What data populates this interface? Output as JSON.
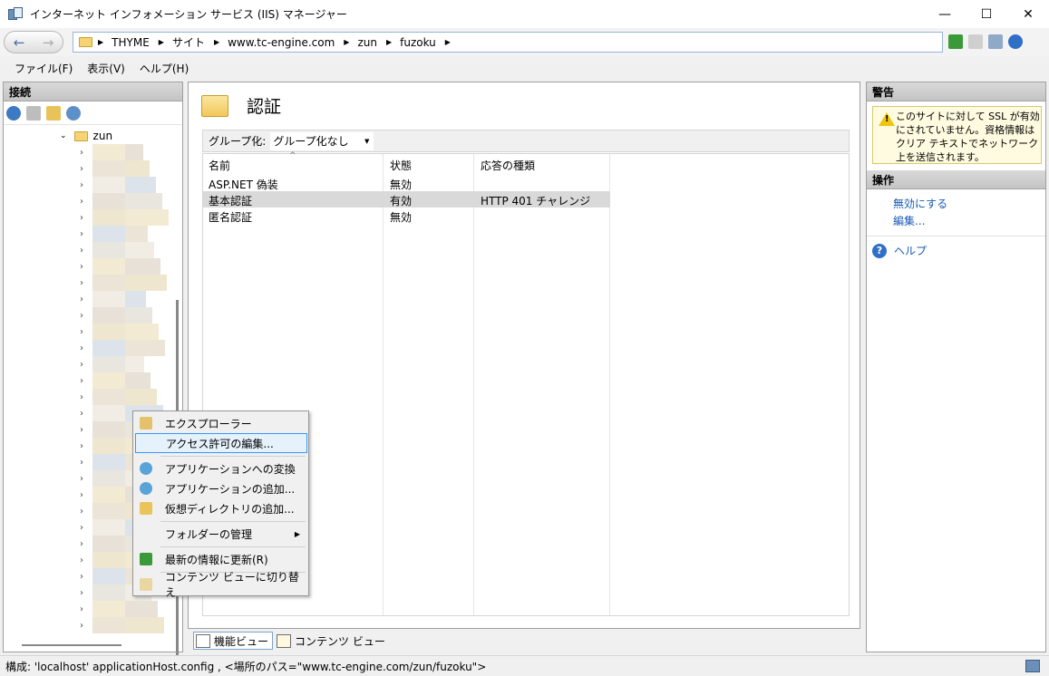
{
  "window": {
    "title": "インターネット インフォメーション サービス (IIS) マネージャー",
    "min": "—",
    "max": "☐",
    "close": "✕"
  },
  "address": {
    "crumbs": [
      "THYME",
      "サイト",
      "www.tc-engine.com",
      "zun",
      "fuzoku"
    ]
  },
  "menu": [
    "ファイル(F)",
    "表示(V)",
    "ヘルプ(H)"
  ],
  "left": {
    "header": "接続",
    "root_node": "zun"
  },
  "center": {
    "title": "認証",
    "group_label": "グループ化:",
    "group_value": "グループ化なし",
    "columns": [
      "名前",
      "状態",
      "応答の種類"
    ],
    "rows": [
      {
        "name": "ASP.NET 偽装",
        "state": "無効",
        "type": ""
      },
      {
        "name": "基本認証",
        "state": "有効",
        "type": "HTTP 401 チャレンジ"
      },
      {
        "name": "匿名認証",
        "state": "無効",
        "type": ""
      }
    ],
    "view_tabs": [
      "機能ビュー",
      "コンテンツ ビュー"
    ]
  },
  "right": {
    "alert_header": "警告",
    "alert_text": "このサイトに対して SSL が有効にされていません。資格情報はクリア テキストでネットワーク上を送信されます。",
    "actions_header": "操作",
    "actions": [
      "無効にする",
      "編集..."
    ],
    "help": "ヘルプ"
  },
  "context_menu": {
    "items": [
      "エクスプローラー",
      "アクセス許可の編集...",
      "アプリケーションへの変換",
      "アプリケーションの追加...",
      "仮想ディレクトリの追加...",
      "フォルダーの管理",
      "最新の情報に更新(R)",
      "コンテンツ ビューに切り替え"
    ]
  },
  "status": "構成: 'localhost' applicationHost.config , <場所のパス=\"www.tc-engine.com/zun/fuzoku\">",
  "colors": {
    "selection": "#d9d9d9",
    "link": "#1a5bb5",
    "highlight_border": "#3399ff"
  }
}
